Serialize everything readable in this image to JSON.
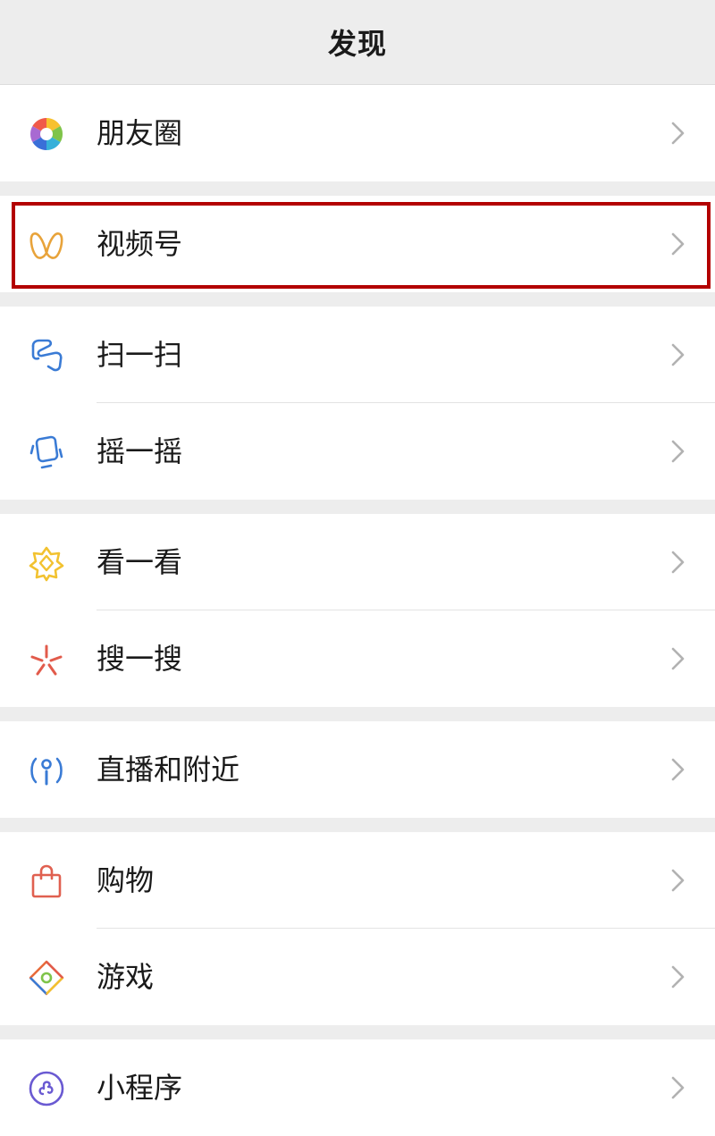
{
  "header": {
    "title": "发现"
  },
  "groups": [
    {
      "items": [
        {
          "label": "朋友圈",
          "icon": "moments-shutter-icon"
        }
      ]
    },
    {
      "items": [
        {
          "label": "视频号",
          "icon": "channels-butterfly-icon"
        }
      ]
    },
    {
      "items": [
        {
          "label": "扫一扫",
          "icon": "scan-icon"
        },
        {
          "label": "摇一摇",
          "icon": "shake-icon"
        }
      ]
    },
    {
      "items": [
        {
          "label": "看一看",
          "icon": "top-stories-icon"
        },
        {
          "label": "搜一搜",
          "icon": "search-spark-icon"
        }
      ]
    },
    {
      "items": [
        {
          "label": "直播和附近",
          "icon": "live-nearby-icon"
        }
      ]
    },
    {
      "items": [
        {
          "label": "购物",
          "icon": "shopping-bag-icon"
        },
        {
          "label": "游戏",
          "icon": "games-icon"
        }
      ]
    },
    {
      "items": [
        {
          "label": "小程序",
          "icon": "mini-programs-icon"
        }
      ]
    }
  ],
  "highlight": {
    "target": "视频号",
    "color": "#b30000"
  },
  "colors": {
    "background": "#ededed",
    "row": "#ffffff",
    "text": "#1a1a1a",
    "chevron": "#b2b2b2"
  }
}
